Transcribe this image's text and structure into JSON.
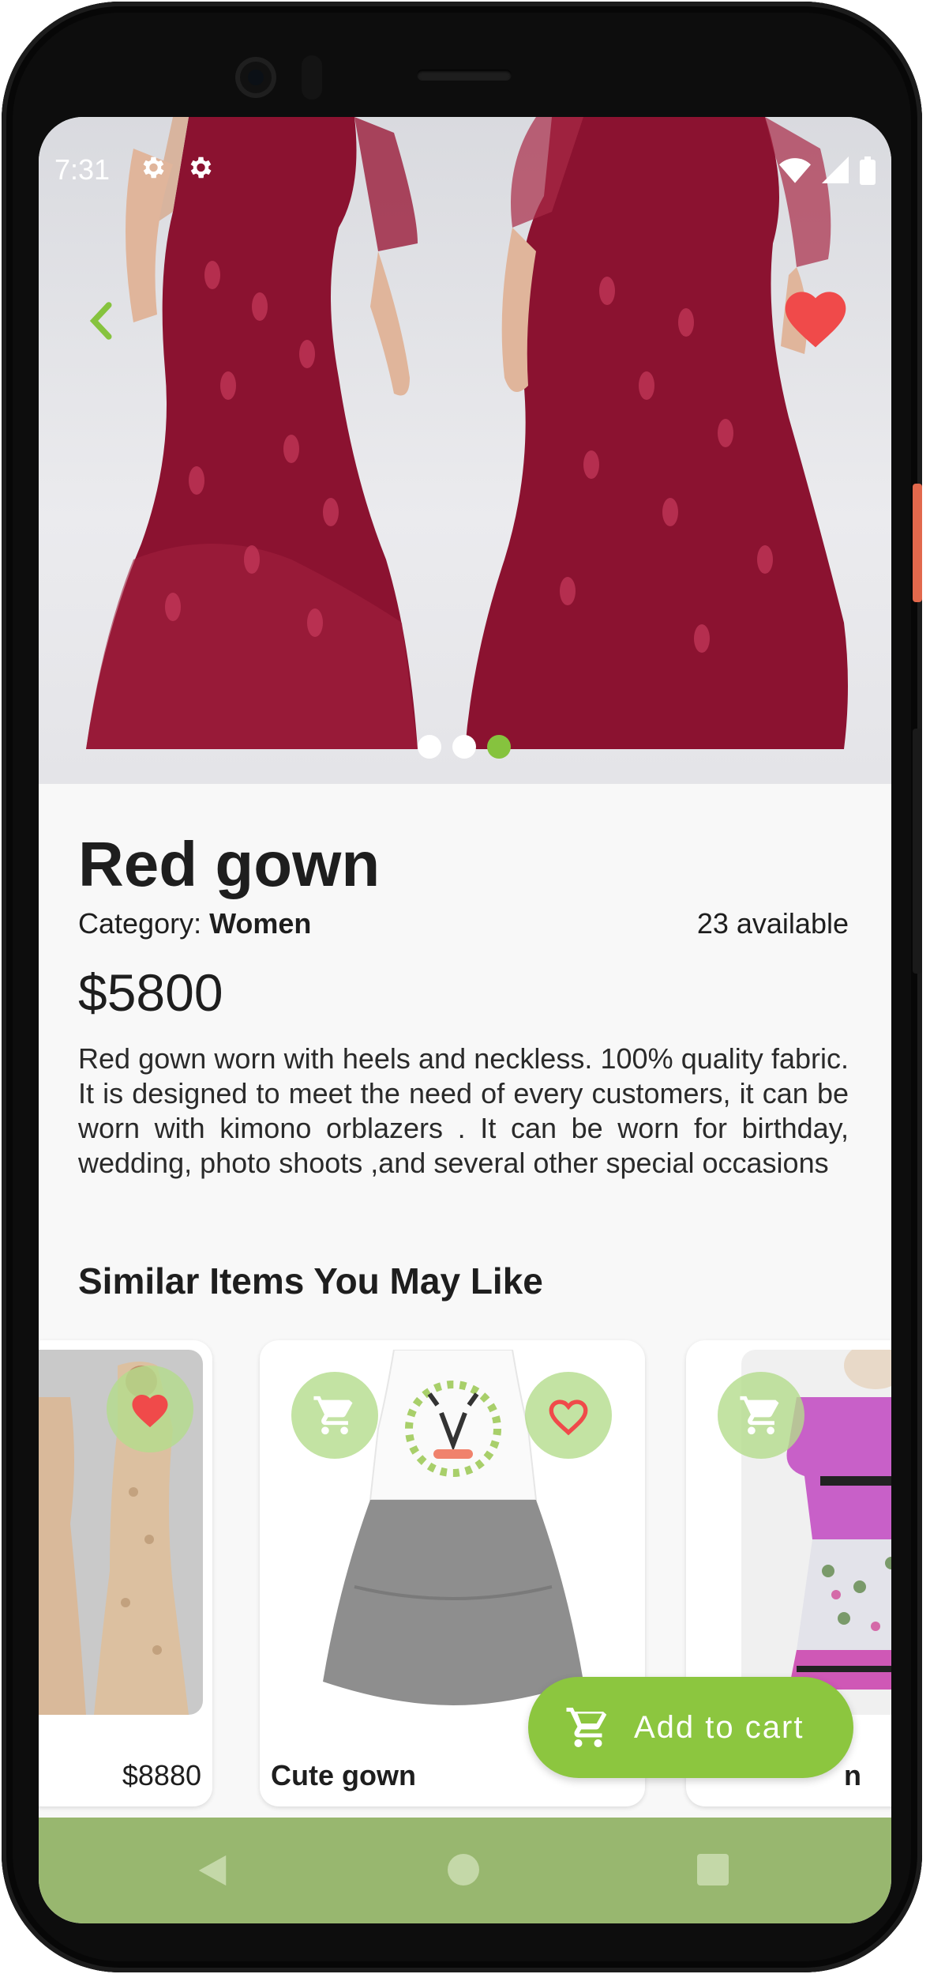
{
  "status_bar": {
    "time": "7:31"
  },
  "product": {
    "title": "Red gown",
    "category_label": "Category: ",
    "category_value": "Women",
    "available": "23 available",
    "price": "$5800",
    "description": "Red gown worn with heels and neckless. 100% quality fabric. It is designed to meet the need of every customers, it can be worn with  kimono orblazers . It can be worn for birthday, wedding, photo shoots ,and  several other special occasions",
    "favorited": true
  },
  "carousel": {
    "total": 3,
    "active_index": 2
  },
  "similar": {
    "title": "Similar Items You May Like",
    "items": [
      {
        "name": "",
        "price": "$8880",
        "favorited": true
      },
      {
        "name": "Cute gown",
        "price": "",
        "favorited": false
      },
      {
        "name": "n",
        "price": "",
        "favorited": false
      }
    ]
  },
  "add_to_cart": {
    "label": "Add to cart"
  },
  "colors": {
    "accent": "#8cc63f",
    "heart": "#f04a4a",
    "navbar": "#98b76f",
    "gown": "#8b1230"
  },
  "icons": {
    "back": "chevron-left-icon",
    "favorite": "heart-icon",
    "cart": "shopping-cart-icon",
    "settings": "gear-icon"
  }
}
